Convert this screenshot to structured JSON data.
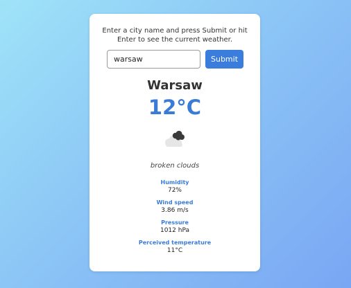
{
  "intro_text": "Enter a city name and press Submit or hit Enter to see the current weather.",
  "search": {
    "value": "warsaw",
    "submit_label": "Submit"
  },
  "weather": {
    "city": "Warsaw",
    "temperature": "12°C",
    "icon": "broken-clouds-icon",
    "description": "broken clouds"
  },
  "stats": [
    {
      "label": "Humidity",
      "value": "72%"
    },
    {
      "label": "Wind speed",
      "value": "3.86 m/s"
    },
    {
      "label": "Pressure",
      "value": "1012 hPa"
    },
    {
      "label": "Perceived temperature",
      "value": "11°C"
    }
  ],
  "colors": {
    "accent": "#3a7bd8",
    "button": "#3b7ddd",
    "card": "#ffffff"
  }
}
